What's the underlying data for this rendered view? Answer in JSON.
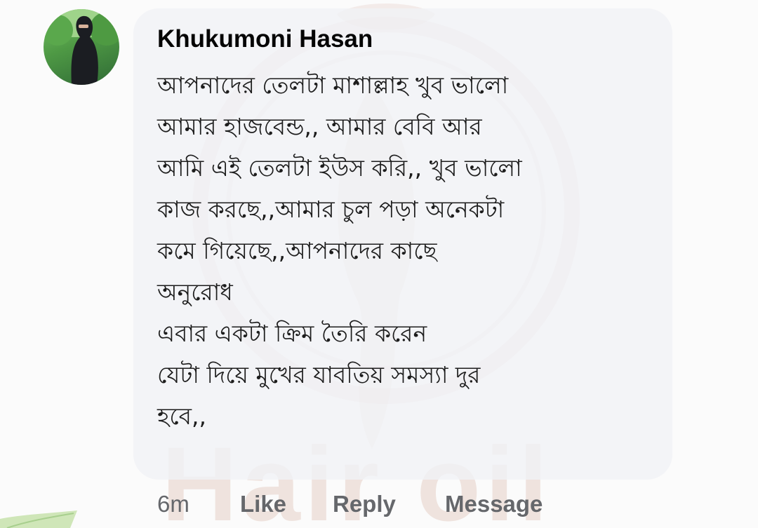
{
  "comment": {
    "author": "Khukumoni Hasan",
    "lines": [
      "আপনাদের তেলটা  মাশাল্লাহ খুব ভালো",
      "আমার হাজবেন্ড,, আমার বেবি আর",
      "আমি এই তেলটা ইউস করি,, খুব ভালো",
      "কাজ করছে,,আমার চুল পড়া অনেকটা",
      "কমে গিয়েছে,,আপনাদের কাছে",
      "অনুরোধ",
      "এবার একটা ক্রিম তৈরি করেন",
      "যেটা দিয়ে মুখের যাবতিয় সমস্যা দুর",
      "হবে,,"
    ]
  },
  "actions": {
    "time": "6m",
    "like": "Like",
    "reply": "Reply",
    "message": "Message"
  },
  "watermark": {
    "text": "Hair oil"
  },
  "colors": {
    "bubble": "#f0f2f5",
    "text": "#050505",
    "meta": "#65676b",
    "watermark": "#c48c78"
  }
}
